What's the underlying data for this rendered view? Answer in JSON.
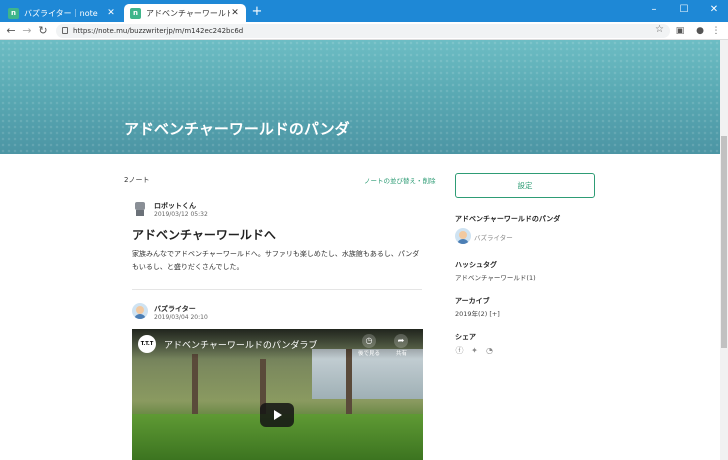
{
  "browser": {
    "tabs": [
      {
        "label": "バズライター｜note",
        "favicon": "n",
        "active": false
      },
      {
        "label": "アドベンチャーワールドのパンダ｜バズライ",
        "favicon": "n",
        "active": true
      }
    ],
    "new_tab": "+",
    "window_controls": [
      "–",
      "☐",
      "✕"
    ],
    "url": "https://note.mu/buzzwriterjp/m/m142ec242bc6d"
  },
  "hero": {
    "title": "アドベンチャーワールドのパンダ"
  },
  "main": {
    "count": "2ノート",
    "reorder_link": "ノートの並び替え・削除",
    "notes": [
      {
        "author": "ロボットくん",
        "date": "2019/03/12 05:32",
        "title": "アドベンチャーワールドへ",
        "body": "家族みんなでアドベンチャーワールドへ。サファリも楽しめたし、水族館もあるし、パンダもいるし、と盛りだくさんでした。"
      },
      {
        "author": "バズライター",
        "date": "2019/03/04 20:10",
        "video": {
          "channel_logo": "T.T.T",
          "title": "アドベンチャーワールドのパンダラブ",
          "watch_later": "後で見る",
          "share": "共有"
        }
      }
    ]
  },
  "sidebar": {
    "settings_button": "設定",
    "magazine_heading": "アドベンチャーワールドのパンダ",
    "magazine_owner": "バズライター",
    "hashtag_heading": "ハッシュタグ",
    "hashtag": "アドベンチャーワールド(1)",
    "archive_heading": "アーカイブ",
    "archive": "2019年(2) [+]",
    "share_heading": "シェア",
    "share_icons": [
      "facebook-icon",
      "twitter-icon",
      "rss-icon"
    ]
  },
  "colors": {
    "accent": "#2e9c75",
    "tabbar": "#1e88d6",
    "hero": "#5aaab4"
  }
}
